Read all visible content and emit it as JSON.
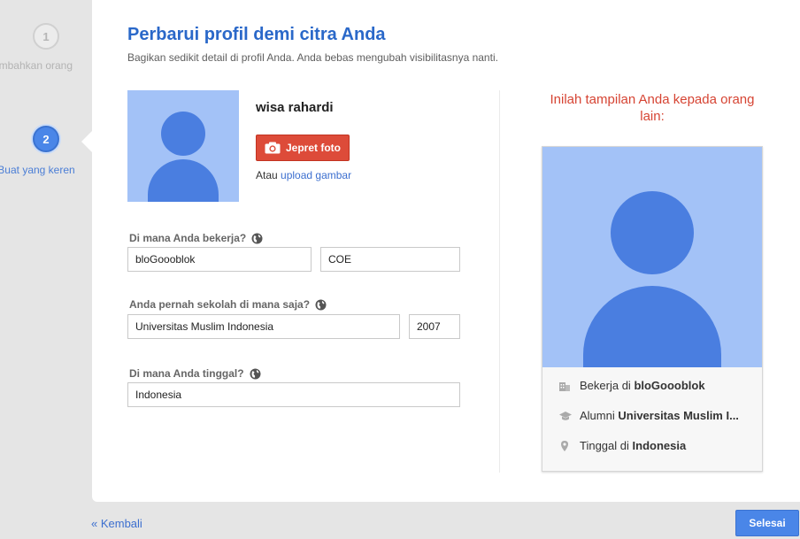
{
  "steps": [
    {
      "number": "1",
      "label": "Tambahkan orang"
    },
    {
      "number": "2",
      "label": "Buat yang keren"
    }
  ],
  "header": {
    "title": "Perbarui profil demi citra Anda",
    "subtitle": "Bagikan sedikit detail di profil Anda. Anda bebas mengubah visibilitasnya nanti."
  },
  "profile": {
    "name": "wisa rahardi",
    "photo_button": "Jepret foto",
    "or_text": "Atau",
    "upload_link": "upload gambar"
  },
  "form": {
    "work_label": "Di mana Anda bekerja?",
    "work_company": "bloGoooblok",
    "work_title": "COE",
    "school_label": "Anda pernah sekolah di mana saja?",
    "school_name": "Universitas Muslim Indonesia",
    "school_year": "2007",
    "live_label": "Di mana Anda tinggal?",
    "live_place": "Indonesia"
  },
  "preview": {
    "title": "Inilah tampilan Anda kepada orang lain:",
    "work_prefix": "Bekerja di",
    "work_value": "bloGoooblok",
    "alumni_prefix": "Alumni",
    "alumni_value": "Universitas Muslim I...",
    "live_prefix": "Tinggal di",
    "live_value": "Indonesia"
  },
  "footer": {
    "back_label": "« Kembali",
    "done_label": "Selesai"
  },
  "colors": {
    "accent": "#4a86e8",
    "title_blue": "#2a68c9",
    "photo_button_red": "#dd4b39",
    "avatar_bg": "#a3c2f7",
    "avatar_figure": "#4a7ee0"
  }
}
